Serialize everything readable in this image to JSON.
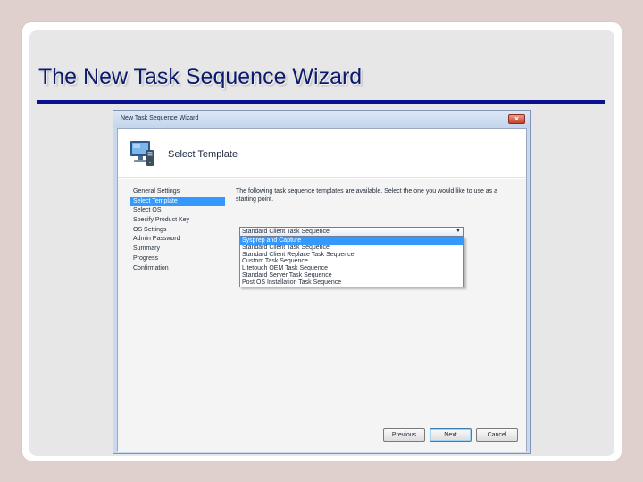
{
  "slide": {
    "title": "The New Task Sequence Wizard"
  },
  "dialog": {
    "title": "New Task Sequence Wizard",
    "close_label": "×",
    "header_icon": "computer-icon",
    "page_title": "Select Template",
    "steps": [
      "General Settings",
      "Select Template",
      "Select OS",
      "Specify Product Key",
      "OS Settings",
      "Admin Password",
      "Summary",
      "Progress",
      "Confirmation"
    ],
    "active_step": "Select Template",
    "description": "The following task sequence templates are available. Select the one you would like to use as a starting point.",
    "template_combo": {
      "value": "Standard Client Task Sequence",
      "arrow": "▼"
    },
    "template_options": [
      "Sysprep and Capture",
      "Standard Client Task Sequence",
      "Standard Client Replace Task Sequence",
      "Custom Task Sequence",
      "Litetouch OEM Task Sequence",
      "Standard Server Task Sequence",
      "Post OS Installation Task Sequence"
    ],
    "selected_option": "Sysprep and Capture",
    "buttons": {
      "previous": "Previous",
      "next": "Next",
      "cancel": "Cancel"
    }
  },
  "colors": {
    "title_text": "#0c1a6b",
    "title_rule": "#0a1190",
    "selection": "#3399ff",
    "background": "#dfcfcd"
  }
}
